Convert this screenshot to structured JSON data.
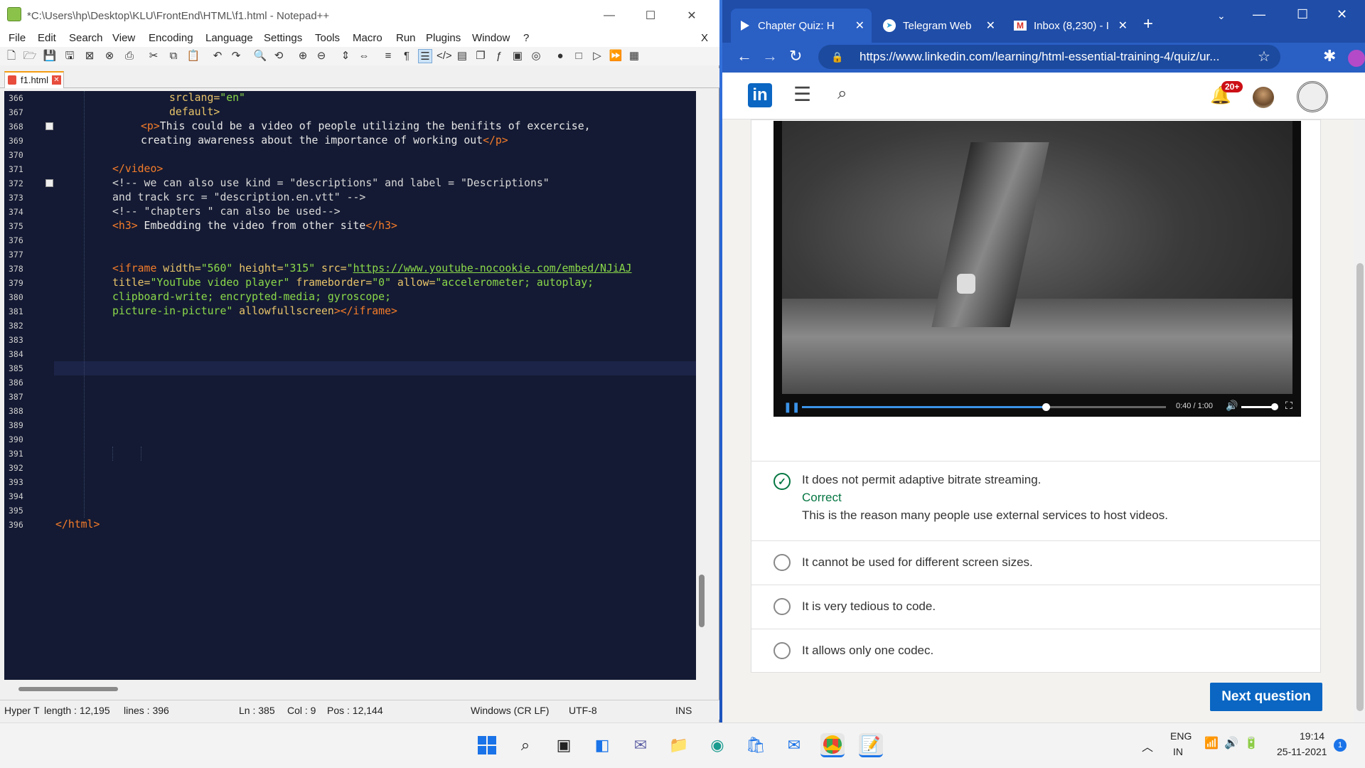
{
  "notepad": {
    "title": "*C:\\Users\\hp\\Desktop\\KLU\\FrontEnd\\HTML\\f1.html - Notepad++",
    "menu": [
      "File",
      "Edit",
      "Search",
      "View",
      "Encoding",
      "Language",
      "Settings",
      "Tools",
      "Macro",
      "Run",
      "Plugins",
      "Window",
      "?"
    ],
    "close_doc": "X",
    "tab_label": "f1.html",
    "line_numbers": [
      "366",
      "367",
      "368",
      "369",
      "370",
      "371",
      "372",
      "373",
      "374",
      "375",
      "376",
      "377",
      "378",
      "379",
      "380",
      "381",
      "382",
      "383",
      "384",
      "385",
      "386",
      "387",
      "388",
      "389",
      "390",
      "391",
      "392",
      "393",
      "394",
      "395",
      "396"
    ],
    "code": {
      "l366": [
        "srclang=",
        "\"en\""
      ],
      "l367": "default>",
      "l368": [
        "<p>",
        "This could be a video of people utilizing the benifits of excercise,"
      ],
      "l369": [
        "creating awareness about the importance of working out",
        "</p>"
      ],
      "l371": "</video>",
      "l372": "<!-- we can also use kind = \"descriptions\" and label = \"Descriptions\"",
      "l373": "and track src = \"description.en.vtt\" -->",
      "l374": "<!-- \"chapters \" can also be used-->",
      "l375": [
        "<h3>",
        " Embedding the video from other site",
        "</h3>"
      ],
      "l378": [
        "<iframe ",
        "width=",
        "\"560\"",
        " height=",
        "\"315\"",
        " src=",
        "\"",
        "https://www.youtube-nocookie.com/embed/NJiAJ"
      ],
      "l379": [
        "title=",
        "\"YouTube video player\"",
        " frameborder=",
        "\"0\"",
        " allow=",
        "\"accelerometer; autoplay;"
      ],
      "l380": "clipboard-write; encrypted-media; gyroscope;",
      "l381": [
        "picture-in-picture\"",
        " allowfullscreen",
        "></iframe>"
      ],
      "l396": "</html>"
    },
    "status": {
      "type": "Hyper T",
      "length": "length : 12,195",
      "lines": "lines : 396",
      "ln": "Ln : 385",
      "col": "Col : 9",
      "pos": "Pos : 12,144",
      "eol": "Windows (CR LF)",
      "encoding": "UTF-8",
      "mode": "INS"
    }
  },
  "chrome": {
    "tabs": [
      {
        "label": "Chapter Quiz: H",
        "icon": "linkedin-learning-icon",
        "active": true
      },
      {
        "label": "Telegram Web",
        "icon": "telegram-icon",
        "active": false
      },
      {
        "label": "Inbox (8,230) - I",
        "icon": "gmail-icon",
        "active": false
      }
    ],
    "new_tab": "+",
    "url": "https://www.linkedin.com/learning/html-essential-training-4/quiz/ur..."
  },
  "linkedin": {
    "logo": "in",
    "notification_badge": "20+",
    "video": {
      "time": "0:40 / 1:00",
      "progress": 0.67,
      "volume": 0.8
    },
    "answers": [
      {
        "text": "It does not permit adaptive bitrate streaming.",
        "state": "correct",
        "verdict": "Correct",
        "explanation": "This is the reason many people use external services to host videos."
      },
      {
        "text": "It cannot be used for different screen sizes.",
        "state": "unselected"
      },
      {
        "text": "It is very tedious to code.",
        "state": "unselected"
      },
      {
        "text": "It allows only one codec.",
        "state": "unselected"
      }
    ],
    "next_button": "Next question"
  },
  "taskbar": {
    "lang": "ENG",
    "region": "IN",
    "time": "19:14",
    "date": "25-11-2021",
    "notification_count": "1"
  },
  "colors": {
    "editor_bg": "#141a33",
    "tag": "#f57c2a",
    "attr": "#e9c46a",
    "value": "#8bd94a",
    "linkedin_blue": "#0a66c2",
    "correct_green": "#057642"
  }
}
